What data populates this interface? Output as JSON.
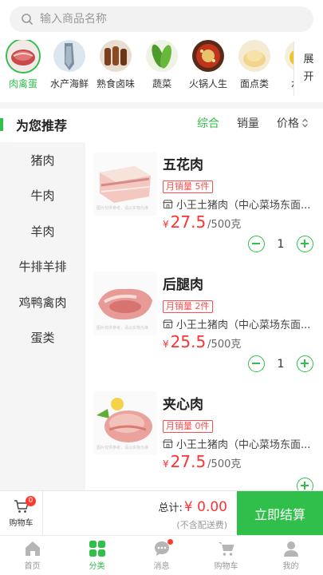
{
  "search": {
    "placeholder": "输入商品名称"
  },
  "categories": [
    {
      "label": "肉禽蛋",
      "icon": "meat-thumb",
      "active": true
    },
    {
      "label": "水产海鲜",
      "icon": "fish-thumb"
    },
    {
      "label": "熟食卤味",
      "icon": "braised-thumb"
    },
    {
      "label": "蔬菜",
      "icon": "vegetable-thumb"
    },
    {
      "label": "火锅人生",
      "icon": "hotpot-thumb"
    },
    {
      "label": "面点类",
      "icon": "bun-thumb"
    },
    {
      "label": "水果",
      "icon": "fruit-thumb"
    }
  ],
  "expand": {
    "line1": "展",
    "line2": "开"
  },
  "section": {
    "title": "为您推荐"
  },
  "sorts": {
    "comprehensive": "综合",
    "sales": "销量",
    "price": "价格"
  },
  "sidebar": {
    "items": [
      {
        "label": "猪肉"
      },
      {
        "label": "牛肉"
      },
      {
        "label": "羊肉"
      },
      {
        "label": "牛排羊排"
      },
      {
        "label": "鸡鸭禽肉"
      },
      {
        "label": "蛋类"
      }
    ]
  },
  "products": [
    {
      "name": "五花肉",
      "sales": "月销量 5件",
      "shop": "小王土猪肉（中心菜场东面...",
      "currency": "¥",
      "price": "27.5",
      "unit": "/500克",
      "qty": "1",
      "watermark": "图片仅供参考，请以实物为准"
    },
    {
      "name": "后腿肉",
      "sales": "月销量 2件",
      "shop": "小王土猪肉（中心菜场东面...",
      "currency": "¥",
      "price": "25.5",
      "unit": "/500克",
      "qty": "1",
      "watermark": "图片仅供参考，请以实物为准"
    },
    {
      "name": "夹心肉",
      "sales": "月销量 0件",
      "shop": "小王土猪肉（中心菜场东面...",
      "currency": "¥",
      "price": "27.5",
      "unit": "/500克",
      "qty": "",
      "watermark": "图片仅供参考，请以实物为准"
    }
  ],
  "cart": {
    "label": "购物车",
    "badge": "0",
    "total_label": "总计:",
    "total": "¥ 0.00",
    "note": "(不含配送费)",
    "checkout": "立即结算"
  },
  "tabs": [
    {
      "label": "首页",
      "icon": "home-icon"
    },
    {
      "label": "分类",
      "icon": "category-icon",
      "active": true
    },
    {
      "label": "消息",
      "icon": "message-icon"
    },
    {
      "label": "购物车",
      "icon": "cart-icon"
    },
    {
      "label": "我的",
      "icon": "profile-icon"
    }
  ],
  "colors": {
    "accent": "#2fbf4a",
    "price": "#ff3333",
    "badge": "#ff3b30"
  }
}
